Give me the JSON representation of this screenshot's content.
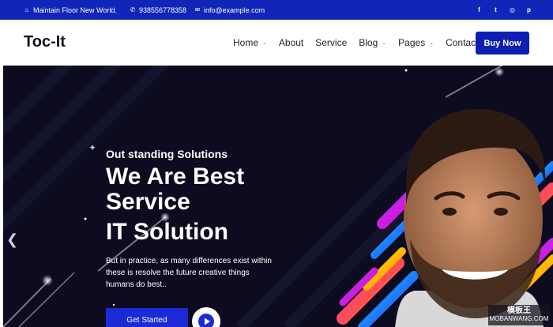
{
  "topbar": {
    "address": "Maintain Floor New World.",
    "phone": "938556778358",
    "email": "info@example.com",
    "address_icon": "home-icon",
    "phone_icon": "phone-icon",
    "email_icon": "mail-icon",
    "socials": [
      {
        "name": "facebook-icon",
        "glyph": "f"
      },
      {
        "name": "twitter-icon",
        "glyph": "t"
      },
      {
        "name": "instagram-icon",
        "glyph": "◎"
      },
      {
        "name": "pinterest-icon",
        "glyph": "p"
      }
    ],
    "background": "#1126b8"
  },
  "nav": {
    "logo": "Toc-It",
    "items": [
      {
        "label": "Home",
        "has_dropdown": true
      },
      {
        "label": "About",
        "has_dropdown": false
      },
      {
        "label": "Service",
        "has_dropdown": false
      },
      {
        "label": "Blog",
        "has_dropdown": true
      },
      {
        "label": "Pages",
        "has_dropdown": true
      },
      {
        "label": "Contact",
        "has_dropdown": false
      }
    ],
    "buy_button": "Buy Now",
    "accent": "#0e1db3"
  },
  "hero": {
    "eyebrow": "Out standing Solutions",
    "headline_line1": "We Are Best Service",
    "headline_line2": "IT Solution",
    "description": "But in practice, as many differences exist within these is resolve the future creative things humans do best..",
    "cta_label": "Get Started",
    "play_icon": "play-icon",
    "prev_icon": "chevron-left-icon",
    "background": "#0c0b1f"
  },
  "watermark": {
    "line1": "模板王",
    "line2": "MOBANWANG.COM"
  }
}
